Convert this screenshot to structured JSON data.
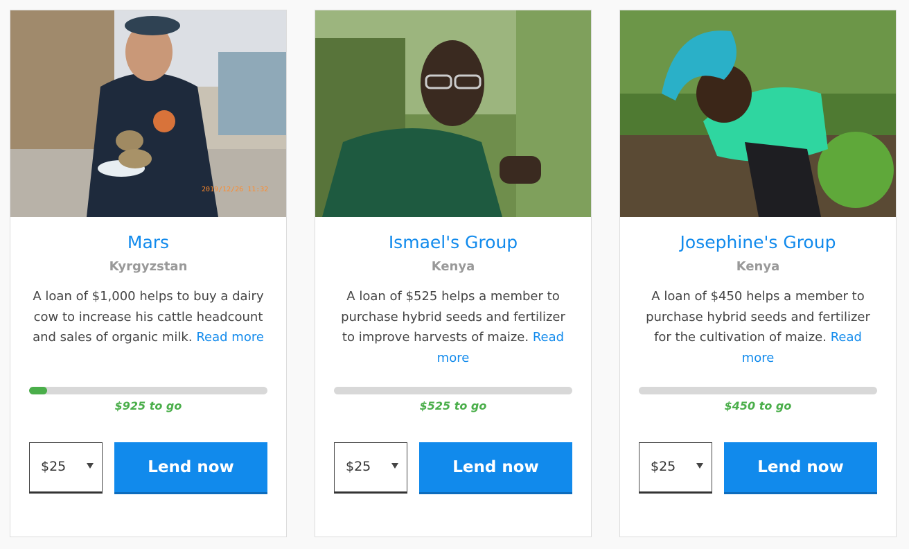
{
  "colors": {
    "accent": "#118aec",
    "progress": "#4aae4a",
    "track": "#d8d8d8",
    "muted": "#999999"
  },
  "loans": [
    {
      "name": "Mars",
      "country": "Kyrgyzstan",
      "description": "A loan of $1,000 helps to buy a dairy cow to increase his cattle headcount and sales of organic milk.",
      "read_more": "Read more",
      "photo_timestamp": "2019/12/26  11:32",
      "progress_fraction": 0.075,
      "to_go": "$925 to go",
      "amount": "$25",
      "lend_label": "Lend now"
    },
    {
      "name": "Ismael's Group",
      "country": "Kenya",
      "description": "A loan of $525 helps a member to purchase hybrid seeds and fertilizer to improve harvests of maize.",
      "read_more": "Read more",
      "progress_fraction": 0,
      "to_go": "$525 to go",
      "amount": "$25",
      "lend_label": "Lend now"
    },
    {
      "name": "Josephine's Group",
      "country": "Kenya",
      "description": "A loan of $450 helps a member to purchase hybrid seeds and fertilizer for the cultivation of maize.",
      "read_more": "Read more",
      "progress_fraction": 0,
      "to_go": "$450 to go",
      "amount": "$25",
      "lend_label": "Lend now"
    }
  ]
}
